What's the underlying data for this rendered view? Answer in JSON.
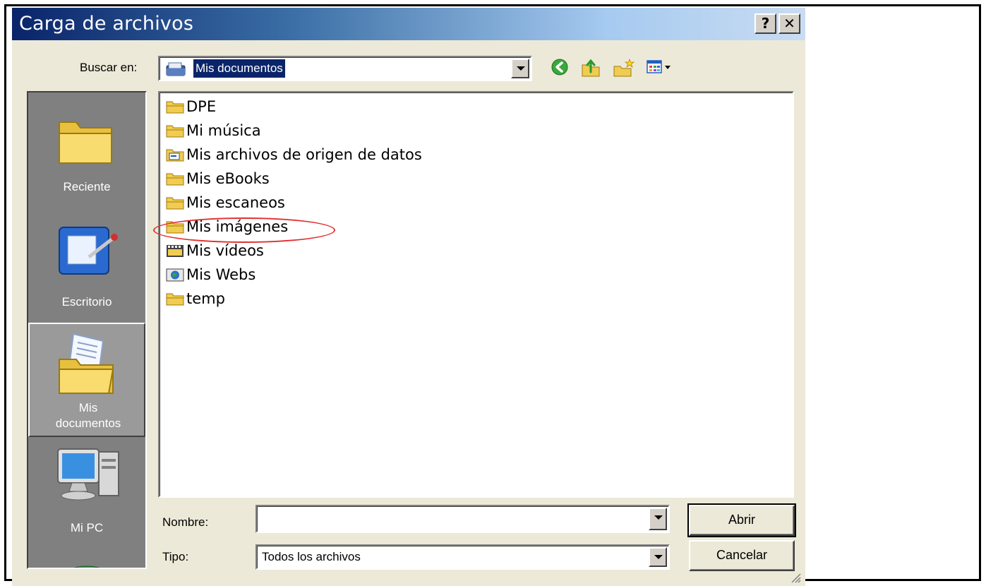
{
  "dialog": {
    "title": "Carga de archivos",
    "help_button": "?",
    "close_button": "✕"
  },
  "lookin": {
    "label": "Buscar en:",
    "value": "Mis documentos",
    "icon": "my-documents-icon"
  },
  "toolbar": {
    "icons": [
      "back-icon",
      "up-folder-icon",
      "new-folder-icon",
      "view-menu-icon"
    ]
  },
  "places": {
    "items": [
      {
        "label": "Reciente",
        "icon": "recent-folder-icon",
        "selected": false
      },
      {
        "label": "Escritorio",
        "icon": "desktop-icon",
        "selected": false
      },
      {
        "label": "Mis documentos",
        "icon": "my-documents-icon",
        "selected": true
      },
      {
        "label": "Mi PC",
        "icon": "my-computer-icon",
        "selected": false
      },
      {
        "label": "",
        "icon": "network-places-icon",
        "selected": false
      }
    ]
  },
  "files": [
    {
      "name": "DPE",
      "icon": "folder-icon"
    },
    {
      "name": "Mi música",
      "icon": "folder-icon"
    },
    {
      "name": "Mis archivos de origen de datos",
      "icon": "data-source-folder-icon"
    },
    {
      "name": "Mis eBooks",
      "icon": "folder-icon"
    },
    {
      "name": "Mis escaneos",
      "icon": "folder-icon"
    },
    {
      "name": "Mis imágenes",
      "icon": "folder-icon",
      "highlighted": true
    },
    {
      "name": "Mis vídeos",
      "icon": "video-folder-icon"
    },
    {
      "name": "Mis Webs",
      "icon": "web-folder-icon"
    },
    {
      "name": "temp",
      "icon": "folder-icon"
    }
  ],
  "form": {
    "name_label": "Nombre:",
    "name_value": "",
    "type_label": "Tipo:",
    "type_value": "Todos los archivos",
    "open_button": "Abrir",
    "cancel_button": "Cancelar"
  },
  "colors": {
    "title_gradient_start": "#0a246a",
    "dialog_bg": "#ece9d8",
    "places_bg": "#808080",
    "highlight_ellipse": "#e03030"
  }
}
